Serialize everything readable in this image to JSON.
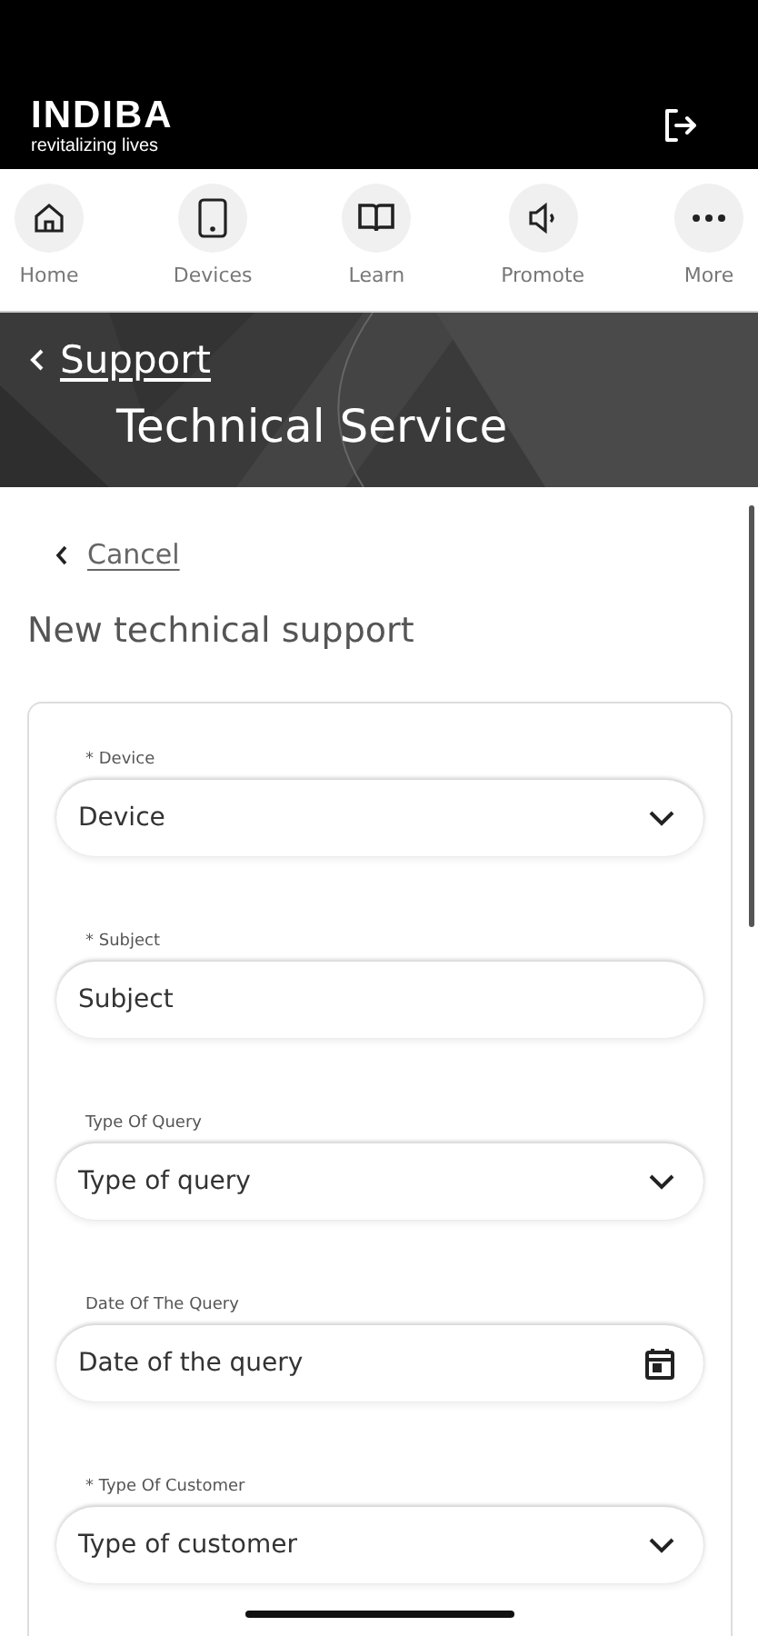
{
  "header": {
    "brand": "INDIBA",
    "tagline": "revitalizing lives"
  },
  "nav": [
    {
      "label": "Home",
      "kind": "home"
    },
    {
      "label": "Devices",
      "kind": "tablet"
    },
    {
      "label": "Learn",
      "kind": "book"
    },
    {
      "label": "Promote",
      "kind": "speaker"
    },
    {
      "label": "More",
      "kind": "dots"
    }
  ],
  "banner": {
    "back": "Support",
    "title": "Technical Service"
  },
  "cancel": "Cancel",
  "page_title": "New technical support",
  "fields": [
    {
      "label": "* Device",
      "placeholder": "Device",
      "kind": "select"
    },
    {
      "label": "* Subject",
      "placeholder": "Subject",
      "kind": "text"
    },
    {
      "label": "Type Of Query",
      "placeholder": "Type of query",
      "kind": "select"
    },
    {
      "label": "Date Of The Query",
      "placeholder": "Date of the query",
      "kind": "date"
    },
    {
      "label": "* Type Of Customer",
      "placeholder": "Type of customer",
      "kind": "select"
    }
  ]
}
